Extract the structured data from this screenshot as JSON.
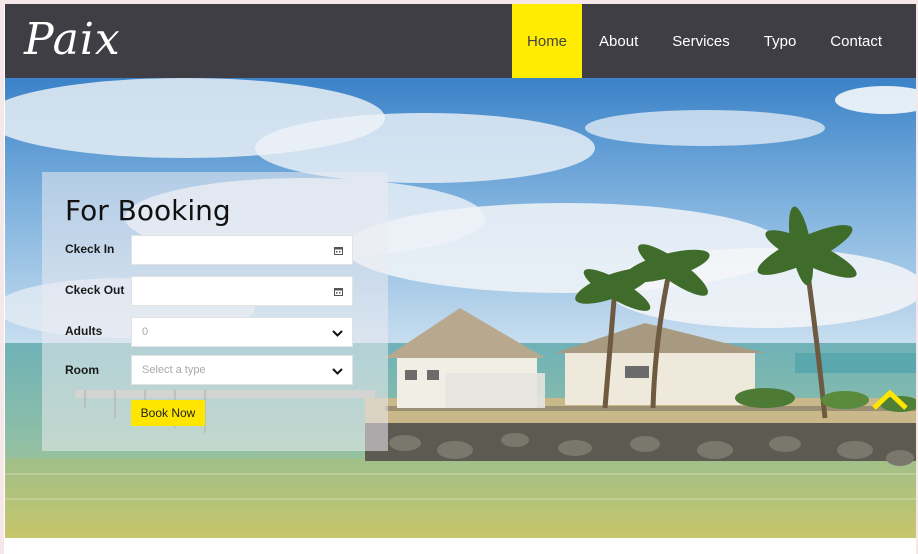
{
  "brand": {
    "logo": "Paix"
  },
  "nav": [
    {
      "label": "Home",
      "active": true
    },
    {
      "label": "About"
    },
    {
      "label": "Services"
    },
    {
      "label": "Typo"
    },
    {
      "label": "Contact"
    }
  ],
  "booking": {
    "title": "For Booking",
    "check_in_label": "Ckeck In",
    "check_in_value": "",
    "check_out_label": "Ckeck Out",
    "check_out_value": "",
    "adults_label": "Adults",
    "adults_value": "0",
    "room_label": "Room",
    "room_placeholder": "Select a type",
    "submit_label": "Book Now"
  },
  "colors": {
    "header_bg": "#403e45",
    "accent": "#ffec00"
  },
  "icons": [
    "calendar-icon",
    "chevron-down-icon",
    "scroll-top-arrow-icon"
  ]
}
